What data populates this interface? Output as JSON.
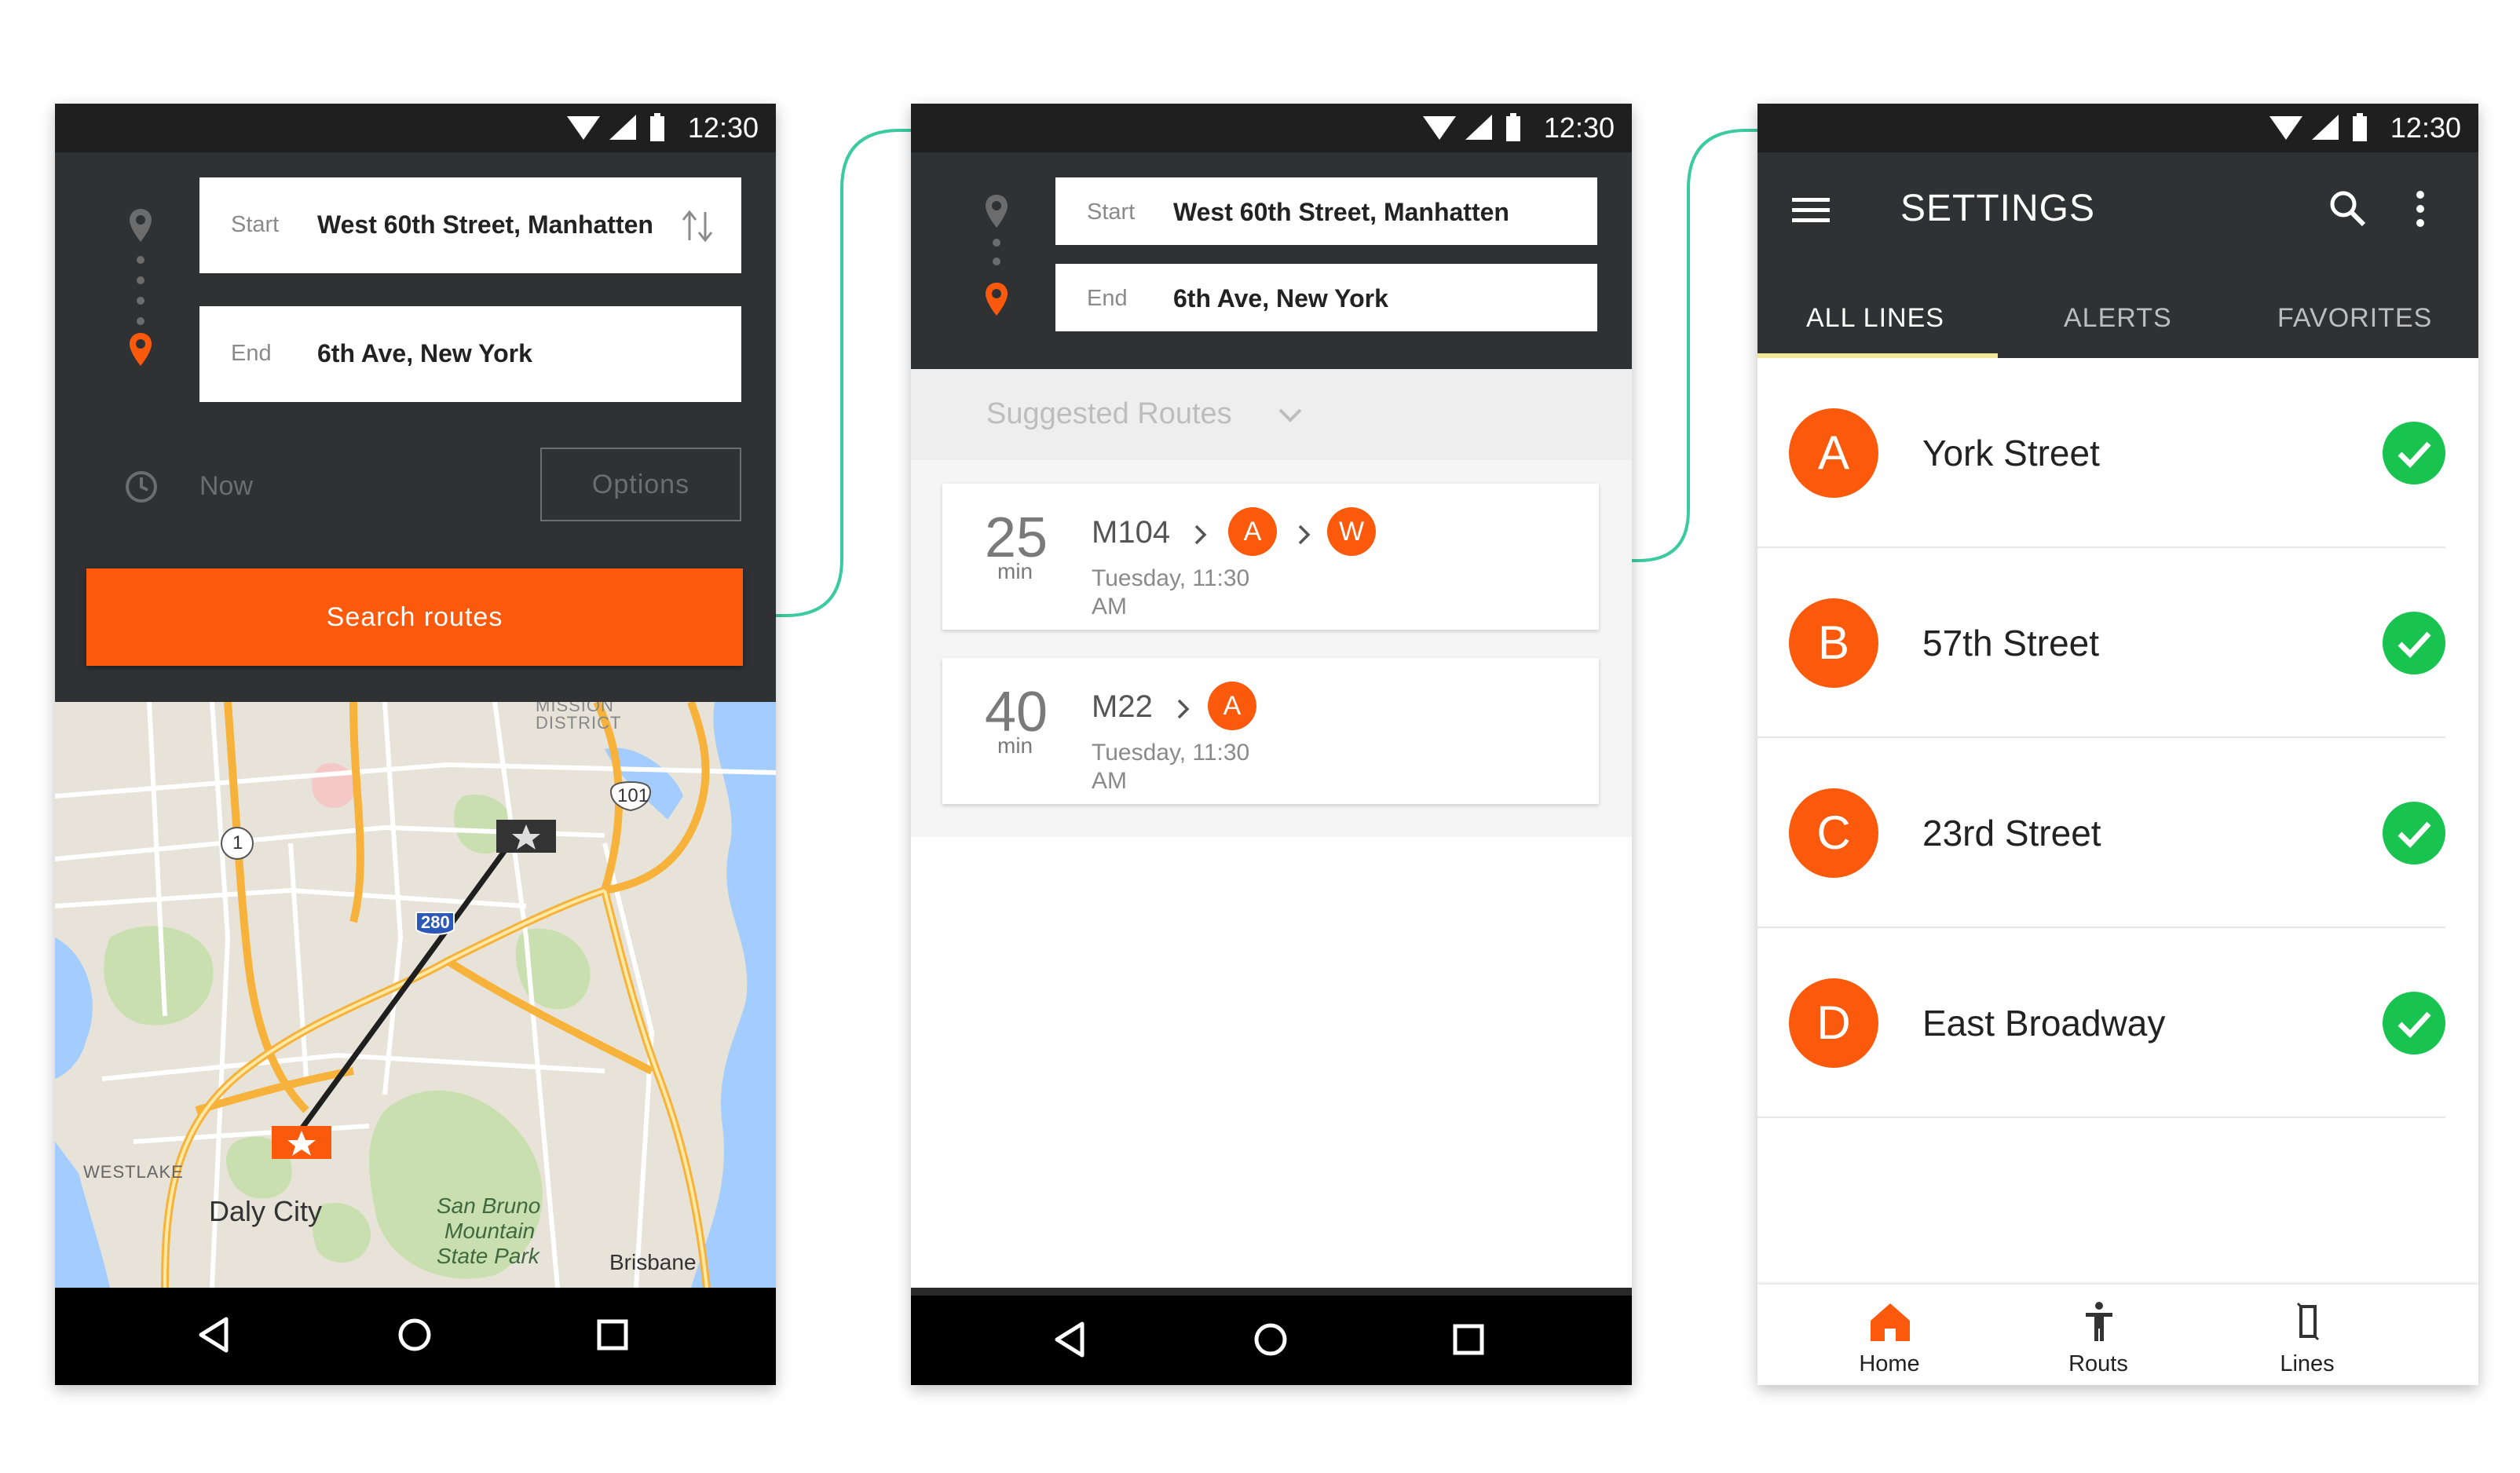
{
  "status": {
    "time": "12:30"
  },
  "screen1": {
    "start_label": "Start",
    "start_value": "West 60th Street, Manhatten",
    "end_label": "End",
    "end_value": "6th Ave, New York",
    "time_label": "Now",
    "options_label": "Options",
    "search_label": "Search routes",
    "map_labels": {
      "mission": "MISSION",
      "district": "DISTRICT",
      "hw101": "101",
      "hw1": "1",
      "hw280": "280",
      "westlake": "WESTLAKE",
      "daly_city": "Daly City",
      "san_bruno_1": "San Bruno",
      "san_bruno_2": "Mountain",
      "san_bruno_3": "State Park",
      "brisbane": "Brisbane"
    }
  },
  "screen2": {
    "start_label": "Start",
    "start_value": "West 60th Street, Manhatten",
    "end_label": "End",
    "end_value": "6th Ave, New York",
    "suggested_label": "Suggested Routes",
    "routes": [
      {
        "minutes": "25",
        "unit": "min",
        "bus": "M104",
        "lines": [
          "A",
          "W"
        ],
        "day": "Tuesday, 11:30",
        "ampm": "AM"
      },
      {
        "minutes": "40",
        "unit": "min",
        "bus": "M22",
        "lines": [
          "A"
        ],
        "day": "Tuesday, 11:30",
        "ampm": "AM"
      }
    ]
  },
  "screen3": {
    "title": "SETTINGS",
    "tabs": [
      "ALL LINES",
      "ALERTS",
      "FAVORITES"
    ],
    "lines": [
      {
        "letter": "A",
        "name": "York Street"
      },
      {
        "letter": "B",
        "name": "57th Street"
      },
      {
        "letter": "C",
        "name": "23rd Street"
      },
      {
        "letter": "D",
        "name": "East Broadway"
      }
    ],
    "bottom_nav": [
      "Home",
      "Routs",
      "Lines"
    ]
  },
  "colors": {
    "accent": "#fb5a0c",
    "dark_panel": "#303133",
    "connector": "#3ccaa0",
    "check": "#18c44f",
    "tab_indicator": "#f3e79a"
  }
}
